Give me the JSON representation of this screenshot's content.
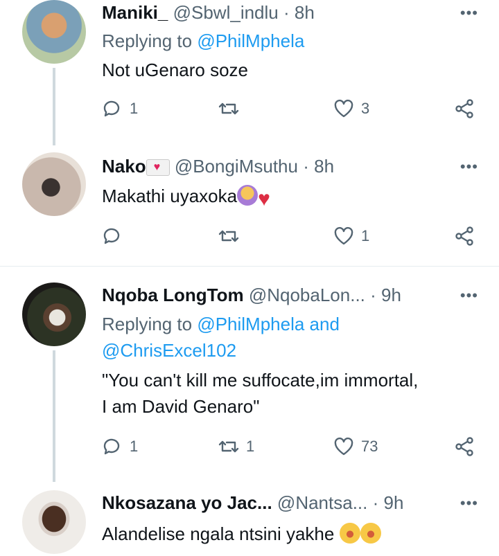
{
  "tweets": [
    {
      "name": "Maniki_",
      "handle": "@Sbwl_indlu",
      "time": "8h",
      "replying_label": "Replying to",
      "replying_to": "@PhilMphela",
      "text": "Not uGenaro soze",
      "replies": "1",
      "retweets": "",
      "likes": "3"
    },
    {
      "name": "Nako",
      "handle": "@BongiMsuthu",
      "time": "8h",
      "text": "Makathi uyaxoka",
      "replies": "",
      "retweets": "",
      "likes": "1"
    },
    {
      "name": "Nqoba LongTom",
      "handle": "@NqobaLon...",
      "time": "9h",
      "replying_label": "Replying to",
      "replying_to": "@PhilMphela and",
      "replying_to_2": "@ChrisExcel102",
      "text": "\"You can't kill me suffocate,im immortal,\nI am David Genaro\"",
      "replies": "1",
      "retweets": "1",
      "likes": "73"
    },
    {
      "name": "Nkosazana yo Jac...",
      "handle": "@Nantsa...",
      "time": "9h",
      "text": "Alandelise ngala ntsini yakhe"
    }
  ],
  "separator": "·",
  "more_label": "•••",
  "icons": [
    "reply-icon",
    "retweet-icon",
    "like-icon",
    "share-icon",
    "more-icon",
    "envelope-heart-emoji",
    "woman-gesturing-no-emoji",
    "broken-heart-emoji",
    "crying-face-emoji"
  ],
  "colors": {
    "text": "#0f1419",
    "secondary": "#536471",
    "link": "#1d9bf0",
    "thread_line": "#cfd9de"
  }
}
